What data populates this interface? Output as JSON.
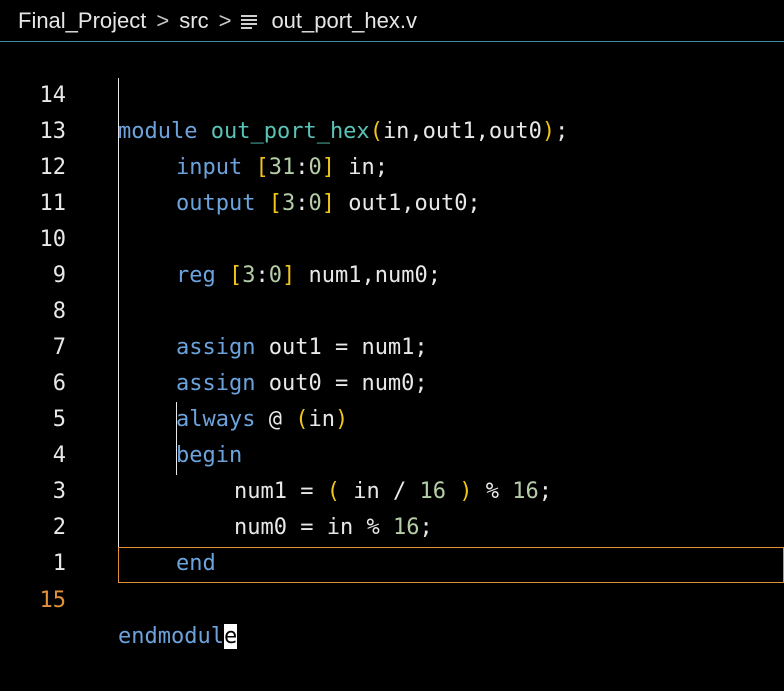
{
  "breadcrumb": {
    "project": "Final_Project",
    "folder": "src",
    "file": "out_port_hex.v",
    "separator": ">"
  },
  "colors": {
    "keyword": "#6ca3dc",
    "function": "#59c3b5",
    "bracket": "#f0c419",
    "number": "#b5cea8",
    "current_line_number": "#e0913a",
    "breadcrumb_border": "#3c8ea0"
  },
  "editor": {
    "lines": [
      {
        "num": "14"
      },
      {
        "num": "13"
      },
      {
        "num": "12"
      },
      {
        "num": "11"
      },
      {
        "num": "10"
      },
      {
        "num": "9"
      },
      {
        "num": "8"
      },
      {
        "num": "7"
      },
      {
        "num": "6"
      },
      {
        "num": "5"
      },
      {
        "num": "4"
      },
      {
        "num": "3"
      },
      {
        "num": "2"
      },
      {
        "num": "1"
      },
      {
        "num": "15"
      }
    ],
    "code": {
      "l14": {
        "kw": "module",
        "name": "out_port_hex",
        "open": "(",
        "args": "in,out1,out0",
        "close": ")",
        "end": ";"
      },
      "l13": {
        "kw": "input",
        "range_open": "[",
        "range_a": "31",
        "range_colon": ":",
        "range_b": "0",
        "range_close": "]",
        "rest": " in;"
      },
      "l12": {
        "kw": "output",
        "range_open": "[",
        "range_a": "3",
        "range_colon": ":",
        "range_b": "0",
        "range_close": "]",
        "rest": " out1,out0;"
      },
      "l10": {
        "kw": "reg",
        "range_open": "[",
        "range_a": "3",
        "range_colon": ":",
        "range_b": "0",
        "range_close": "]",
        "rest": " num1,num0;"
      },
      "l8": {
        "kw": "assign",
        "rest": " out1 = num1;"
      },
      "l7": {
        "kw": "assign",
        "rest": " out0 = num0;"
      },
      "l6": {
        "kw": "always",
        "at": " @ ",
        "open": "(",
        "arg": "in",
        "close": ")"
      },
      "l5": {
        "kw": "begin"
      },
      "l4": {
        "pre": "num1 = ",
        "open": "(",
        "mid": " in / ",
        "n1": "16",
        "close": " )",
        "mod": " % ",
        "n2": "16",
        "end": ";"
      },
      "l3": {
        "pre": "num0 = in % ",
        "n1": "16",
        "end": ";"
      },
      "l2": {
        "kw": "end"
      },
      "l15": {
        "kw": "endmodul",
        "cursor": "e"
      }
    }
  }
}
